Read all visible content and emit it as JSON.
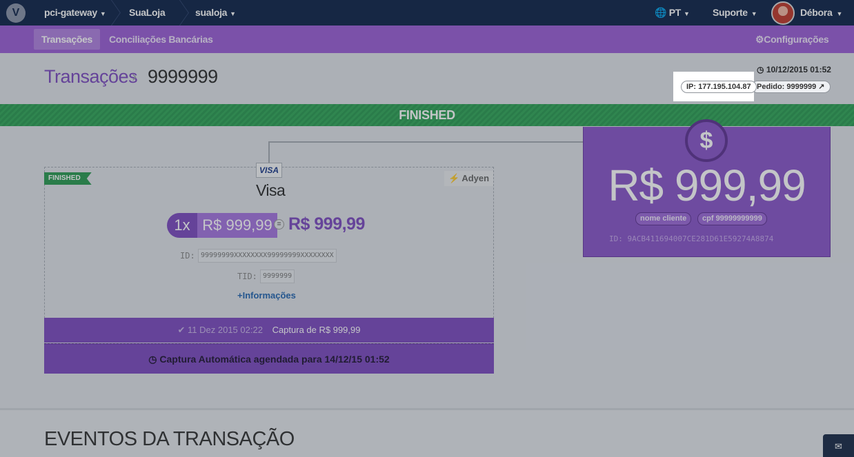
{
  "topnav": {
    "logo": "V",
    "crumbs": [
      "pci-gateway",
      "SuaLoja",
      "sualoja"
    ],
    "language": "PT",
    "support": "Suporte",
    "user": "Débora"
  },
  "subnav": {
    "tabs": [
      "Transações",
      "Conciliações Bancárias"
    ],
    "settings": "Configurações"
  },
  "header": {
    "title": "Transações",
    "transaction_id": "9999999",
    "datetime": "10/12/2015 01:52",
    "ip": "IP: 177.195.104.87",
    "order": "Pedido: 9999999"
  },
  "status": "FINISHED",
  "payment": {
    "ribbon": "FINISHED",
    "card_brand_logo": "VISA",
    "card_brand": "Visa",
    "acquirer": "Adyen",
    "installments": "1x",
    "installment_value": "R$ 999,99",
    "equals": "=",
    "total": "R$ 999,99",
    "id_label": "ID:",
    "id_value": "99999999XXXXXXXX99999999XXXXXXXX",
    "tid_label": "TID:",
    "tid_value": "9999999",
    "more_info": "Informações",
    "capture_date": "11 Dez 2015 02:22",
    "capture_text": "Captura de R$ 999,99",
    "schedule": "Captura Automática agendada para 14/12/15 01:52"
  },
  "amount_card": {
    "symbol": "$",
    "amount": "R$ 999,99",
    "customer_name": "nome cliente",
    "cpf_label": "cpf",
    "cpf_value": "99999999999",
    "gateway_id": "ID: 9ACB411694007CE281D61E59274A8874"
  },
  "events": {
    "title": "EVENTOS DA TRANSAÇÃO"
  },
  "icons": [
    "logo-icon",
    "chevron-down-icon",
    "globe-icon",
    "gear-icon",
    "clock-icon",
    "external-link-icon",
    "dollar-icon",
    "plug-icon",
    "plus-icon",
    "check-icon",
    "chat-icon"
  ],
  "colors": {
    "navy": "#10244a",
    "purple": "#9b5fd6",
    "purple_dark": "#7d4bc0",
    "green": "#2c9a52",
    "link": "#2466b0"
  }
}
